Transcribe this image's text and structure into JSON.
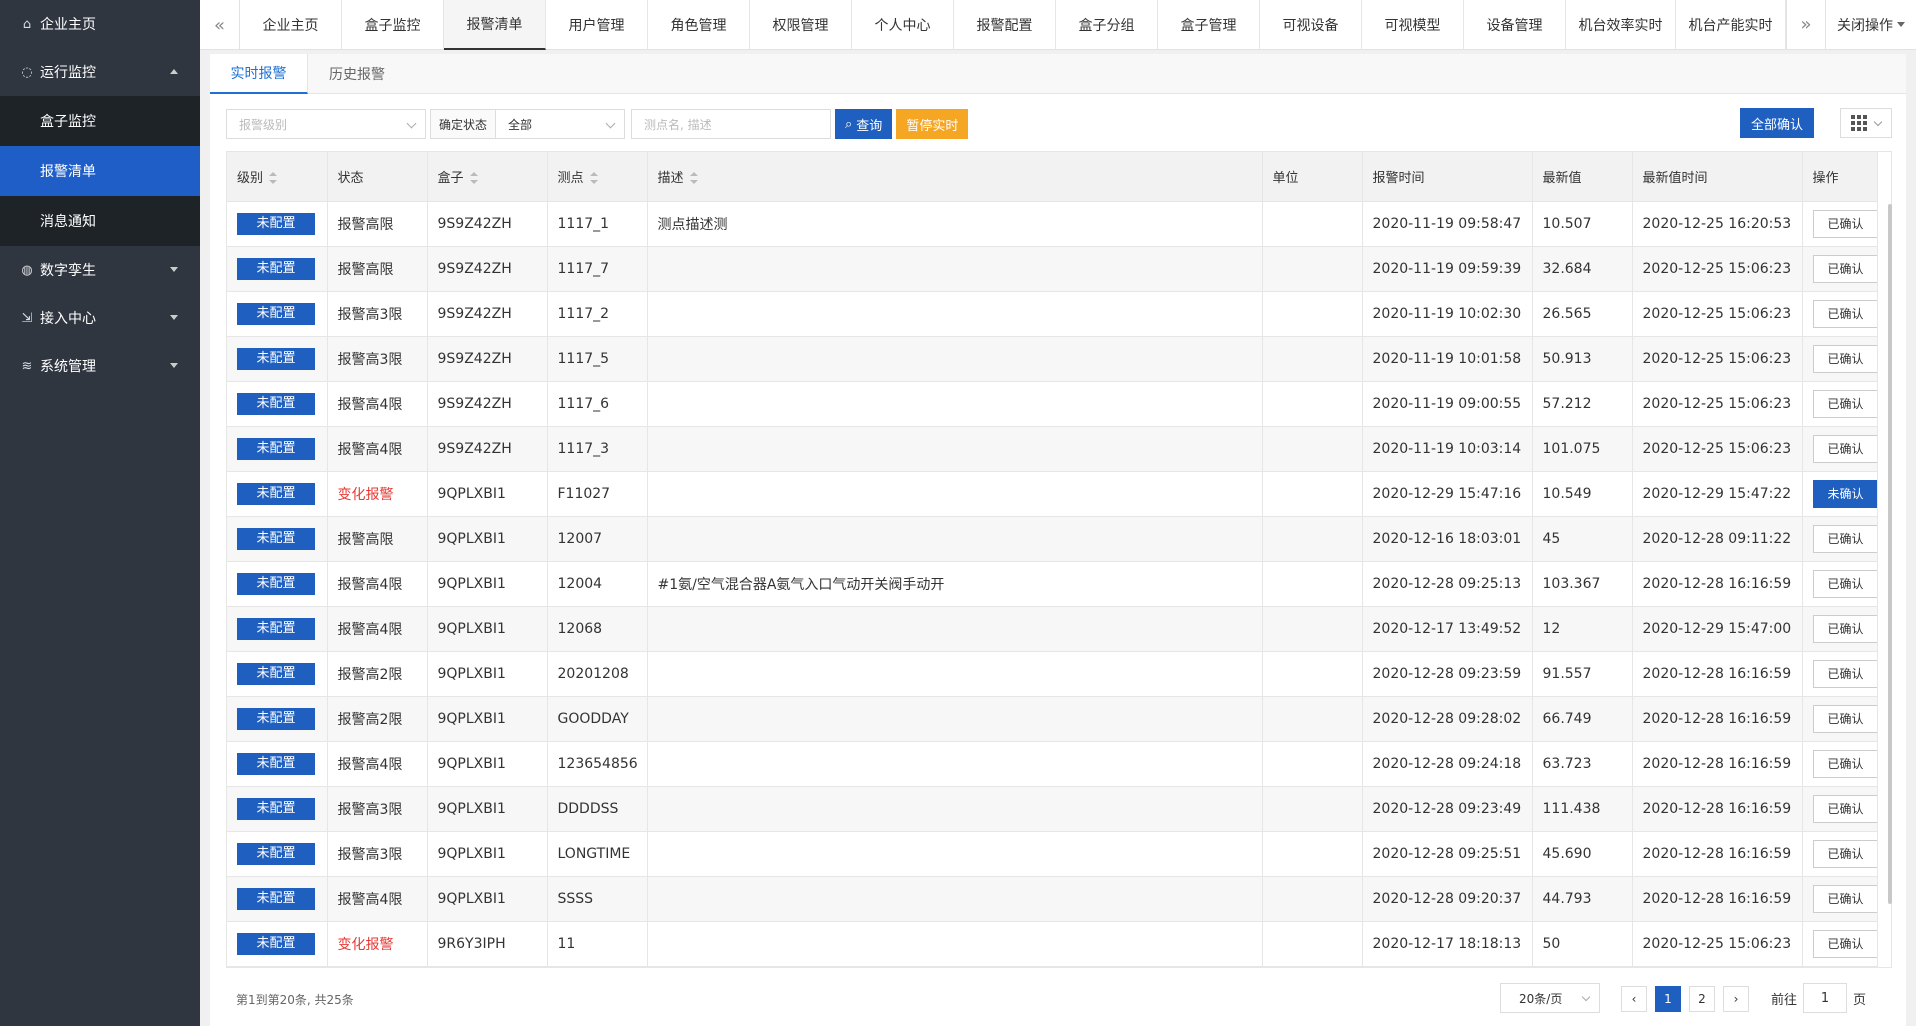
{
  "sidebar": {
    "items": [
      {
        "label": "企业主页",
        "icon": "home-icon"
      },
      {
        "label": "运行监控",
        "icon": "bulb-icon",
        "expanded": true,
        "children": [
          {
            "label": "盒子监控",
            "active": false
          },
          {
            "label": "报警清单",
            "active": true
          },
          {
            "label": "消息通知",
            "active": false
          }
        ]
      },
      {
        "label": "数字孪生",
        "icon": "globe-icon"
      },
      {
        "label": "接入中心",
        "icon": "import-icon"
      },
      {
        "label": "系统管理",
        "icon": "layers-icon"
      }
    ]
  },
  "tabs": {
    "items": [
      "企业主页",
      "盒子监控",
      "报警清单",
      "用户管理",
      "角色管理",
      "权限管理",
      "个人中心",
      "报警配置",
      "盒子分组",
      "盒子管理",
      "可视设备",
      "可视模型",
      "设备管理",
      "机台效率实时",
      "机台产能实时"
    ],
    "active_index": 2,
    "close_ops": "关闭操作"
  },
  "subtabs": {
    "realtime": "实时报警",
    "history": "历史报警"
  },
  "filters": {
    "level_placeholder": "报警级别",
    "confirm_prefix": "确定状态",
    "confirm_value": "全部",
    "search_placeholder": "测点名, 描述",
    "query_label": "查询",
    "pause_label": "暂停实时",
    "confirm_all_label": "全部确认"
  },
  "table": {
    "headers": [
      "级别",
      "状态",
      "盒子",
      "测点",
      "描述",
      "单位",
      "报警时间",
      "最新值",
      "最新值时间",
      "操作"
    ],
    "rows": [
      {
        "level": "未配置",
        "status": "报警高限",
        "box": "9S9Z42ZH",
        "point": "1117_1",
        "desc": "测点描述测",
        "unit": "",
        "time": "2020-11-19 09:58:47",
        "value": "10.507",
        "vtime": "2020-12-25 16:20:53",
        "op": "已确认"
      },
      {
        "level": "未配置",
        "status": "报警高限",
        "box": "9S9Z42ZH",
        "point": "1117_7",
        "desc": "",
        "unit": "",
        "time": "2020-11-19 09:59:39",
        "value": "32.684",
        "vtime": "2020-12-25 15:06:23",
        "op": "已确认"
      },
      {
        "level": "未配置",
        "status": "报警高3限",
        "box": "9S9Z42ZH",
        "point": "1117_2",
        "desc": "",
        "unit": "",
        "time": "2020-11-19 10:02:30",
        "value": "26.565",
        "vtime": "2020-12-25 15:06:23",
        "op": "已确认"
      },
      {
        "level": "未配置",
        "status": "报警高3限",
        "box": "9S9Z42ZH",
        "point": "1117_5",
        "desc": "",
        "unit": "",
        "time": "2020-11-19 10:01:58",
        "value": "50.913",
        "vtime": "2020-12-25 15:06:23",
        "op": "已确认"
      },
      {
        "level": "未配置",
        "status": "报警高4限",
        "box": "9S9Z42ZH",
        "point": "1117_6",
        "desc": "",
        "unit": "",
        "time": "2020-11-19 09:00:55",
        "value": "57.212",
        "vtime": "2020-12-25 15:06:23",
        "op": "已确认"
      },
      {
        "level": "未配置",
        "status": "报警高4限",
        "box": "9S9Z42ZH",
        "point": "1117_3",
        "desc": "",
        "unit": "",
        "time": "2020-11-19 10:03:14",
        "value": "101.075",
        "vtime": "2020-12-25 15:06:23",
        "op": "已确认"
      },
      {
        "level": "未配置",
        "status": "变化报警",
        "box": "9QPLXBI1",
        "point": "F11027",
        "desc": "",
        "unit": "",
        "time": "2020-12-29 15:47:16",
        "value": "10.549",
        "vtime": "2020-12-29 15:47:22",
        "op": "未确认"
      },
      {
        "level": "未配置",
        "status": "报警高限",
        "box": "9QPLXBI1",
        "point": "12007",
        "desc": "",
        "unit": "",
        "time": "2020-12-16 18:03:01",
        "value": "45",
        "vtime": "2020-12-28 09:11:22",
        "op": "已确认"
      },
      {
        "level": "未配置",
        "status": "报警高4限",
        "box": "9QPLXBI1",
        "point": "12004",
        "desc": "#1氨/空气混合器A氨气入口气动开关阀手动开",
        "unit": "",
        "time": "2020-12-28 09:25:13",
        "value": "103.367",
        "vtime": "2020-12-28 16:16:59",
        "op": "已确认"
      },
      {
        "level": "未配置",
        "status": "报警高4限",
        "box": "9QPLXBI1",
        "point": "12068",
        "desc": "",
        "unit": "",
        "time": "2020-12-17 13:49:52",
        "value": "12",
        "vtime": "2020-12-29 15:47:00",
        "op": "已确认"
      },
      {
        "level": "未配置",
        "status": "报警高2限",
        "box": "9QPLXBI1",
        "point": "20201208",
        "desc": "",
        "unit": "",
        "time": "2020-12-28 09:23:59",
        "value": "91.557",
        "vtime": "2020-12-28 16:16:59",
        "op": "已确认"
      },
      {
        "level": "未配置",
        "status": "报警高2限",
        "box": "9QPLXBI1",
        "point": "GOODDAY",
        "desc": "",
        "unit": "",
        "time": "2020-12-28 09:28:02",
        "value": "66.749",
        "vtime": "2020-12-28 16:16:59",
        "op": "已确认"
      },
      {
        "level": "未配置",
        "status": "报警高4限",
        "box": "9QPLXBI1",
        "point": "123654856",
        "desc": "",
        "unit": "",
        "time": "2020-12-28 09:24:18",
        "value": "63.723",
        "vtime": "2020-12-28 16:16:59",
        "op": "已确认"
      },
      {
        "level": "未配置",
        "status": "报警高3限",
        "box": "9QPLXBI1",
        "point": "DDDDSS",
        "desc": "",
        "unit": "",
        "time": "2020-12-28 09:23:49",
        "value": "111.438",
        "vtime": "2020-12-28 16:16:59",
        "op": "已确认"
      },
      {
        "level": "未配置",
        "status": "报警高3限",
        "box": "9QPLXBI1",
        "point": "LONGTIME",
        "desc": "",
        "unit": "",
        "time": "2020-12-28 09:25:51",
        "value": "45.690",
        "vtime": "2020-12-28 16:16:59",
        "op": "已确认"
      },
      {
        "level": "未配置",
        "status": "报警高4限",
        "box": "9QPLXBI1",
        "point": "SSSS",
        "desc": "",
        "unit": "",
        "time": "2020-12-28 09:20:37",
        "value": "44.793",
        "vtime": "2020-12-28 16:16:59",
        "op": "已确认"
      },
      {
        "level": "未配置",
        "status": "变化报警",
        "box": "9R6Y3IPH",
        "point": "11",
        "desc": "",
        "unit": "",
        "time": "2020-12-17 18:18:13",
        "value": "50",
        "vtime": "2020-12-25 15:06:23",
        "op": "已确认"
      }
    ]
  },
  "pagination": {
    "summary": "第1到第20条, 共25条",
    "page_size": "20条/页",
    "pages": [
      "1",
      "2"
    ],
    "current": "1",
    "goto_prefix": "前往",
    "goto_value": "1",
    "goto_suffix": "页"
  },
  "colors": {
    "primary": "#1e5fbf",
    "warning": "#f5a623",
    "danger": "#e53935",
    "sidebar": "#2f3640"
  }
}
